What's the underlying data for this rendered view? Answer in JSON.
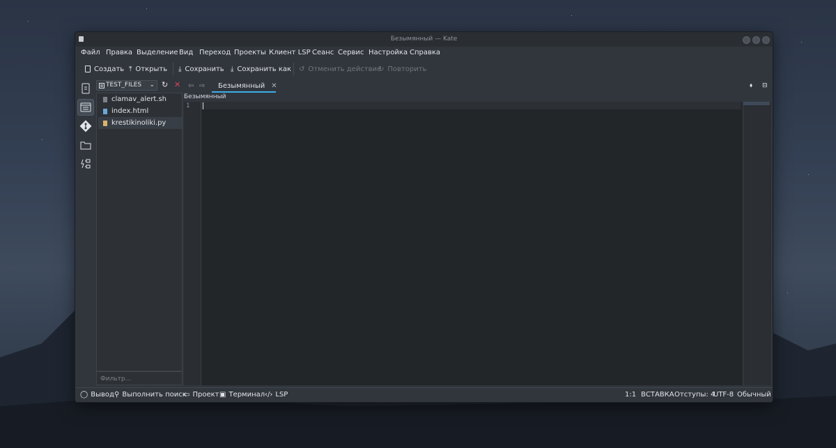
{
  "window": {
    "title": "Безымянный — Kate"
  },
  "menu": [
    "Файл",
    "Правка",
    "Выделение",
    "Вид",
    "Переход",
    "Проекты",
    "Клиент LSP",
    "Сеанс",
    "Сервис",
    "Настройка",
    "Справка"
  ],
  "toolbar": {
    "new": "Создать",
    "open": "Открыть",
    "save": "Сохранить",
    "save_as": "Сохранить как",
    "undo": "Отменить действие",
    "redo": "Повторить"
  },
  "panel": {
    "folder": "TEST_FILES",
    "files": [
      "clamav_alert.sh",
      "index.html",
      "krestikinoliki.py"
    ],
    "filter_placeholder": "Фильтр..."
  },
  "tab": {
    "label": "Безымянный"
  },
  "breadcrumb": "Безымянный",
  "editor": {
    "line_number": "1"
  },
  "status": {
    "output": "Вывод",
    "search": "Выполнить поиск",
    "project": "Проект",
    "terminal": "Терминал",
    "lsp": "LSP",
    "position": "1:1",
    "mode": "ВСТАВКА",
    "indent": "Отступы: 4",
    "encoding": "UTF-8",
    "file_mode": "Обычный"
  },
  "colors": {
    "accent": "#3daee9",
    "close_red": "#da4453"
  }
}
